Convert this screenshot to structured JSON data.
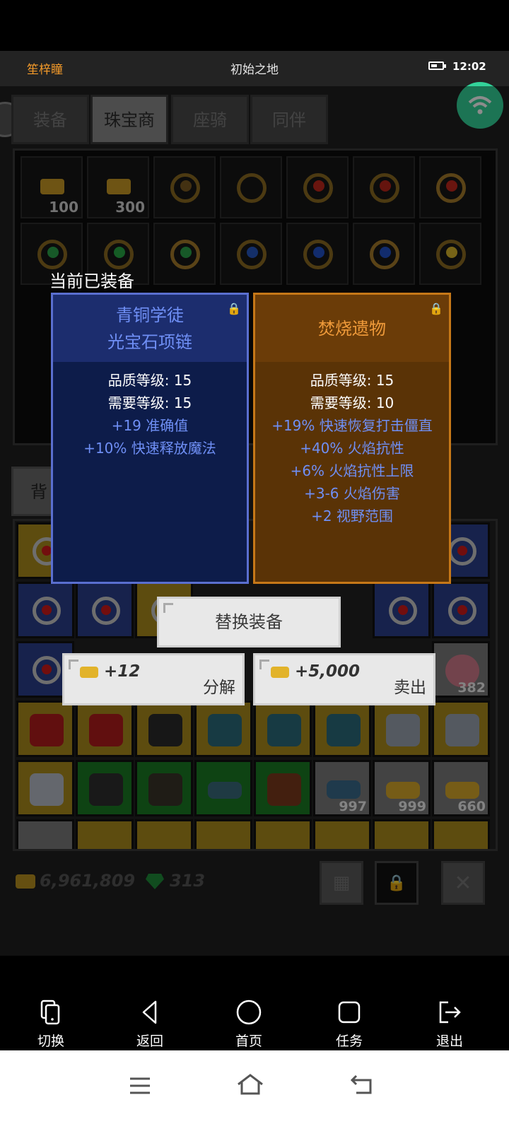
{
  "status_bar": {
    "app_name": "笙梓瞳",
    "title": "初始之地",
    "time": "12:02"
  },
  "tabs": [
    {
      "label": "装备",
      "active": false
    },
    {
      "label": "珠宝商",
      "active": true
    },
    {
      "label": "座骑",
      "active": false
    },
    {
      "label": "同伴",
      "active": false
    }
  ],
  "shop_counts": [
    "100",
    "300"
  ],
  "bag_tab": "背",
  "inventory_counts": [
    "382",
    "997",
    "999",
    "660"
  ],
  "footer": {
    "gold": "6,961,809",
    "gems": "313",
    "close": "✕"
  },
  "compare": {
    "heading": "当前已装备",
    "equipped": {
      "name_line1": "青铜学徒",
      "name_line2": "光宝石项链",
      "quality": "品质等级: 15",
      "required": "需要等级: 15",
      "stats": [
        "+19 准确值",
        "+10% 快速释放魔法"
      ]
    },
    "candidate": {
      "name": "焚烧遗物",
      "quality": "品质等级: 15",
      "required": "需要等级: 10",
      "stats": [
        "+19% 快速恢复打击僵直",
        "+40% 火焰抗性",
        "+6% 火焰抗性上限",
        "+3-6 火焰伤害",
        "+2 视野范围"
      ]
    }
  },
  "actions": {
    "replace": "替换装备",
    "decompose_amount": "+12",
    "decompose": "分解",
    "sell_amount": "+5,000",
    "sell": "卖出"
  },
  "nav": [
    {
      "label": "切换",
      "icon": "switch-icon"
    },
    {
      "label": "返回",
      "icon": "back-icon"
    },
    {
      "label": "首页",
      "icon": "home-icon"
    },
    {
      "label": "任务",
      "icon": "task-icon"
    },
    {
      "label": "退出",
      "icon": "exit-icon"
    }
  ]
}
